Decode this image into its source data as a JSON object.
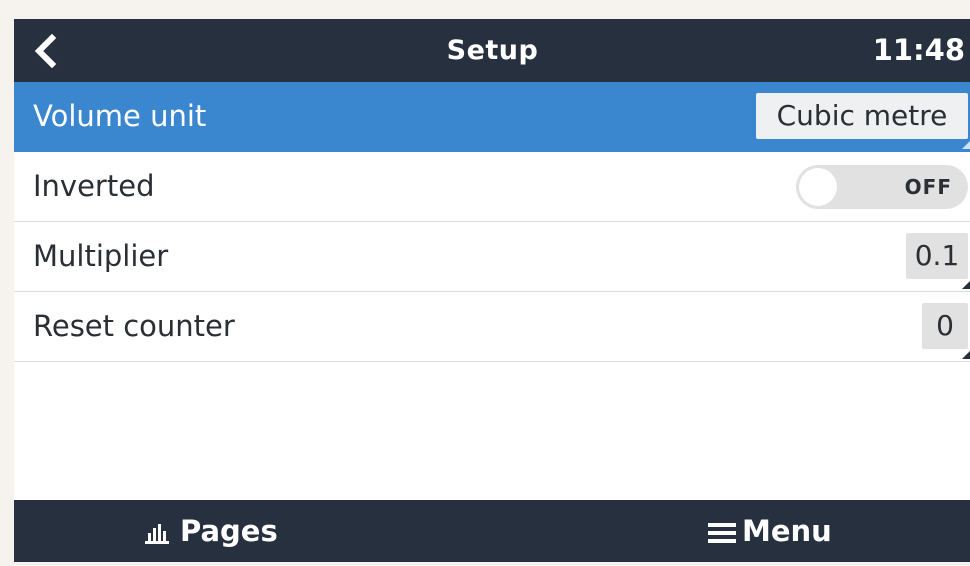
{
  "header": {
    "title": "Setup",
    "time": "11:48",
    "back_icon": "chevron-left-icon"
  },
  "settings": [
    {
      "label": "Volume unit",
      "value": "Cubic metre",
      "selected": true
    },
    {
      "label": "Inverted",
      "toggle_state": "OFF",
      "toggle_on": false
    },
    {
      "label": "Multiplier",
      "value": "0.1"
    },
    {
      "label": "Reset counter",
      "value": "0"
    }
  ],
  "footer": {
    "pages_label": "Pages",
    "pages_icon": "bar-chart-icon",
    "menu_label": "Menu",
    "menu_icon": "hamburger-icon"
  },
  "colors": {
    "bar_bg": "#26303e",
    "selected_row": "#3a87d0",
    "value_box": "#e1e1e1"
  }
}
